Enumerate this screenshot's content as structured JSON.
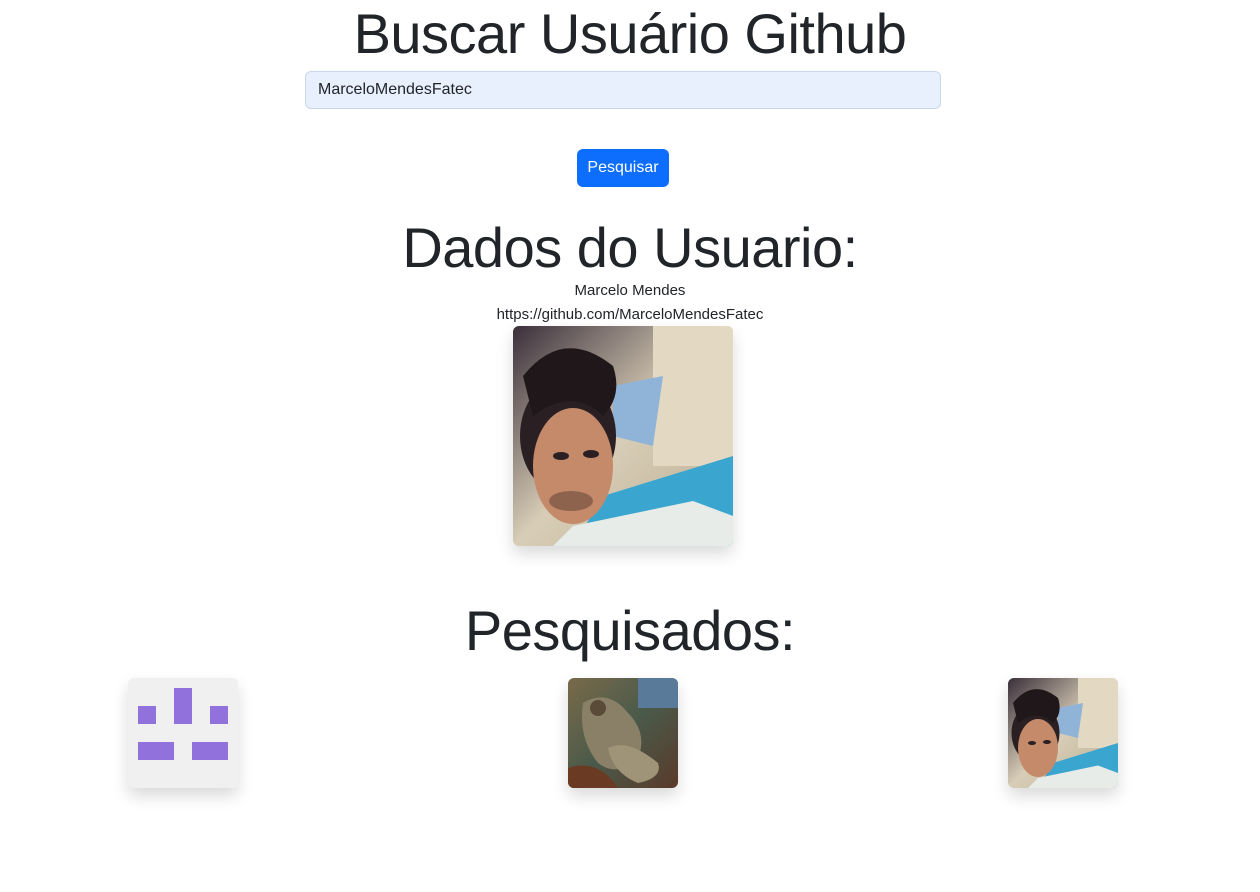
{
  "header": {
    "title": "Buscar Usuário Github"
  },
  "search": {
    "value": "MarceloMendesFatec",
    "button_label": "Pesquisar"
  },
  "user": {
    "section_title": "Dados do Usuario:",
    "name": "Marcelo Mendes",
    "url": "https://github.com/MarceloMendesFatec",
    "avatar_icon": "user-photo-avatar"
  },
  "searched": {
    "section_title": "Pesquisados:",
    "items": [
      {
        "avatar_icon": "identicon-avatar",
        "color": "#9172dc"
      },
      {
        "avatar_icon": "painting-avatar"
      },
      {
        "avatar_icon": "user-photo-avatar"
      }
    ]
  },
  "colors": {
    "primary": "#0d6efd",
    "input_bg": "#e8f0fe",
    "identicon": "#9172dc",
    "identicon_bg": "#f0f0f0"
  }
}
